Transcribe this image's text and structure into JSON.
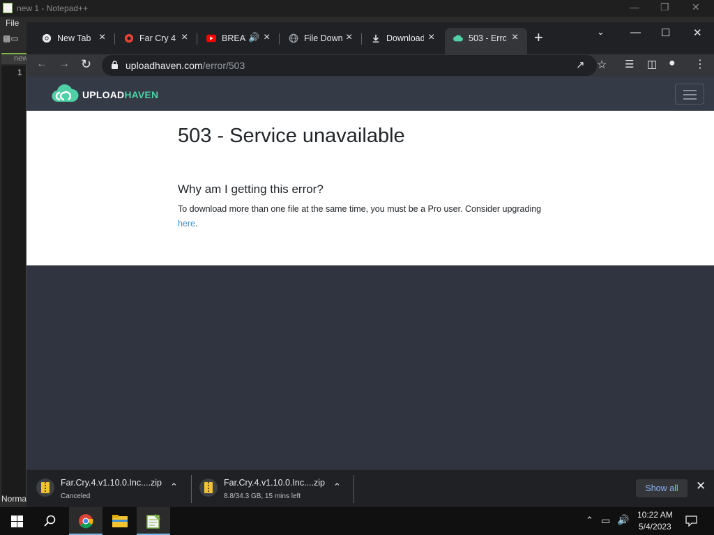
{
  "notepad": {
    "title": "new 1 - Notepad++",
    "menu_file": "File",
    "doc_tab": "new",
    "line_number": "1",
    "status_mode": "Norma"
  },
  "tabs": [
    {
      "label": "New Tab",
      "favicon": "chrome-icon",
      "color": "#e8eaed"
    },
    {
      "label": "Far Cry 4",
      "favicon": "ubisoft-icon",
      "color": "#ea4335"
    },
    {
      "label": "BREAT",
      "favicon": "youtube-icon",
      "color": "#ff0000"
    },
    {
      "label": "File Down",
      "favicon": "globe-icon",
      "color": "#9aa0a6"
    },
    {
      "label": "Download",
      "favicon": "download-icon",
      "color": "#e8eaed"
    },
    {
      "label": "503 - Erro",
      "favicon": "uploadhaven-cloud-icon",
      "color": "#4fd1a5"
    }
  ],
  "address": {
    "domain": "uploadhaven.com",
    "path": "/error/503"
  },
  "site": {
    "logo_part1": "UPLOAD",
    "logo_part2": "HAVEN",
    "accent": "#4fd1a5"
  },
  "error": {
    "title": "503 - Service unavailable",
    "subtitle": "Why am I getting this error?",
    "message": "To download more than one file at the same time, you must be a Pro user. Consider upgrading",
    "link": "here",
    "link_suffix": "."
  },
  "downloads": [
    {
      "filename": "Far.Cry.4.v1.10.0.Inc....zip",
      "status": "Canceled"
    },
    {
      "filename": "Far.Cry.4.v1.10.0.Inc....zip",
      "status": "8.8/34.3 GB, 15 mins left"
    }
  ],
  "downloads_bar": {
    "show_all": "Show all"
  },
  "taskbar": {
    "time": "10:22 AM",
    "date": "5/4/2023"
  }
}
